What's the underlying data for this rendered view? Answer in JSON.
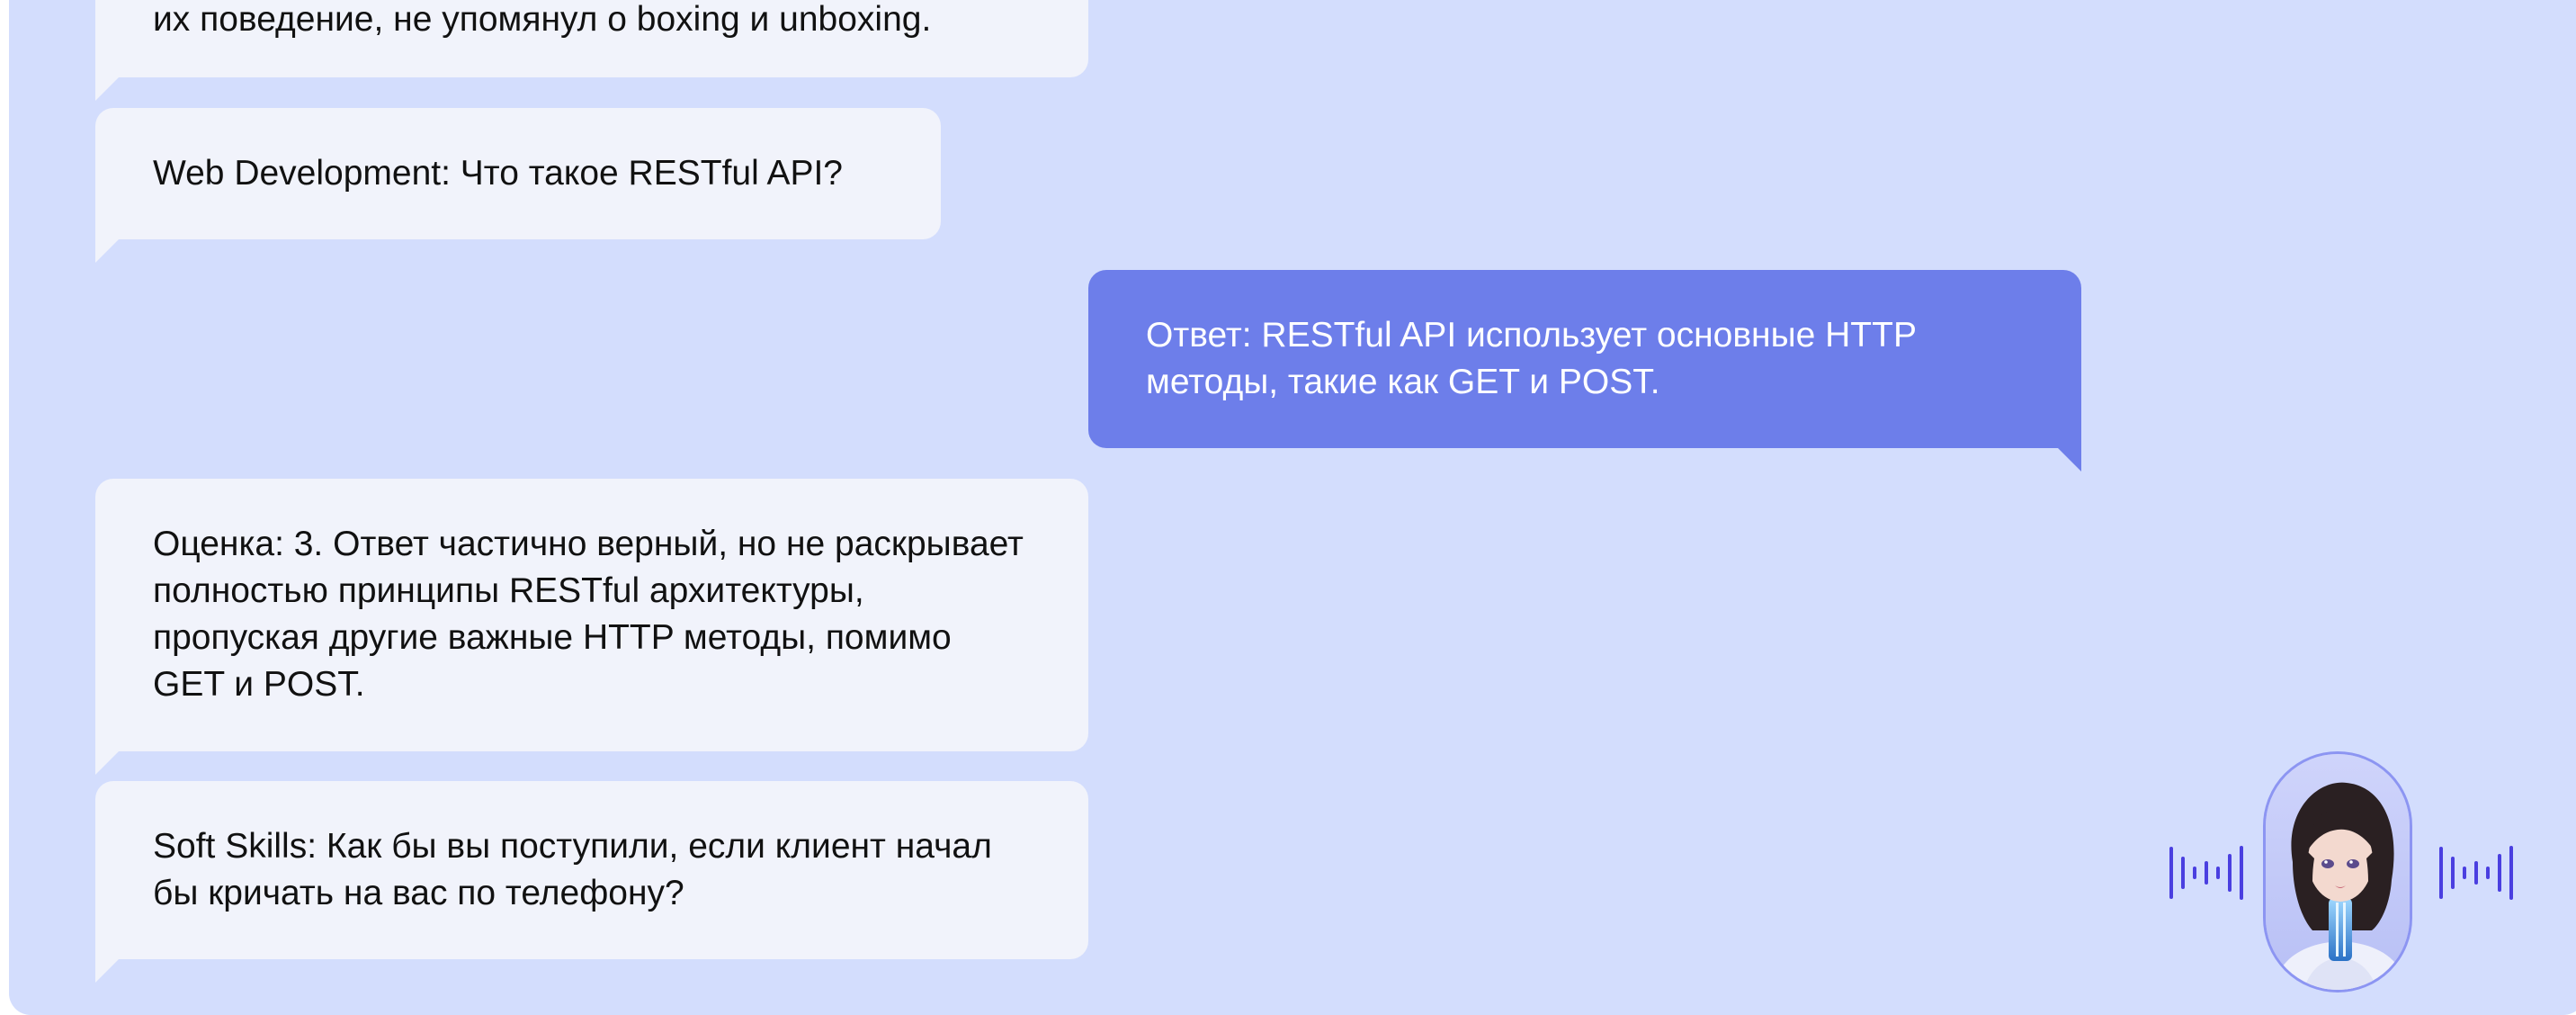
{
  "chat": {
    "messages": [
      {
        "role": "bot",
        "text": "их поведение, не упомянул о boxing и unboxing."
      },
      {
        "role": "bot",
        "text": "Web Development: Что такое RESTful API?"
      },
      {
        "role": "user",
        "text": "Ответ: RESTful API использует основные HTTP методы, такие как GET и POST."
      },
      {
        "role": "bot",
        "text": "Оценка: 3. Ответ частично верный, но не раскрывает полностью принципы RESTful архитектуры, пропуская другие важные HTTP методы, помимо GET и POST."
      },
      {
        "role": "bot",
        "text": "Soft Skills: Как бы вы поступили, если клиент начал бы кричать на вас по телефону?"
      }
    ]
  },
  "assistant": {
    "avatar_icon": "ai-assistant-avatar",
    "voice_icon": "voice-wave-icon",
    "accent_color": "#4a3fe0"
  },
  "colors": {
    "background": "#d3ddfd",
    "bot_bubble": "#f1f3fb",
    "user_bubble": "#6d7eea"
  }
}
